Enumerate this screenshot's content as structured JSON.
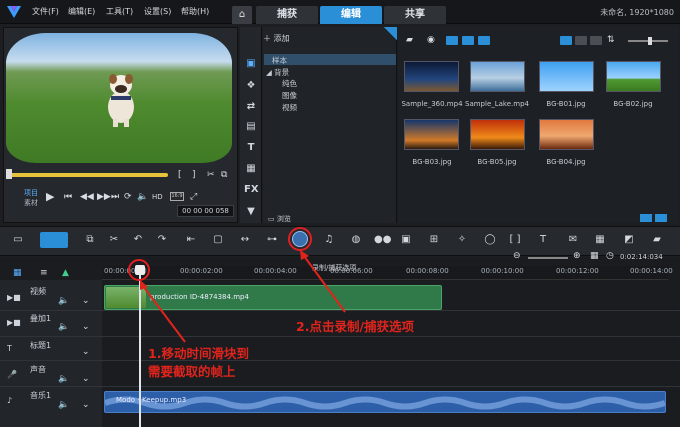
{
  "menu": [
    "文件(F)",
    "编辑(E)",
    "工具(T)",
    "设置(S)",
    "帮助(H)"
  ],
  "tabs": [
    "捕获",
    "编辑",
    "共享"
  ],
  "active_tab": "编辑",
  "project_name": "未命名, 1920*1080",
  "preview": {
    "mode_project": "项目",
    "mode_clip": "素材",
    "quality": "HD",
    "timecode": "00 00 00 058"
  },
  "library": {
    "add_label": "添加",
    "tree": [
      "样本",
      "背景",
      "纯色",
      "图像",
      "视频"
    ],
    "browse_label": "浏览",
    "items": [
      {
        "name": "Sample_360.mp4"
      },
      {
        "name": "Sample_Lake.mp4"
      },
      {
        "name": "BG-B01.jpg"
      },
      {
        "name": "BG-B02.jpg"
      },
      {
        "name": "BG-B03.jpg"
      },
      {
        "name": "BG-B05.jpg"
      },
      {
        "name": "BG-B04.jpg"
      }
    ]
  },
  "toolbar": {
    "tooltip": "录制/捕获选项",
    "timecode_right": "0:02:14:034"
  },
  "ruler": [
    "00:00:00:00",
    "00:00:02:00",
    "00:00:04:00",
    "00:00:06:00",
    "00:00:08:00",
    "00:00:10:00",
    "00:00:12:00",
    "00:00:14:00"
  ],
  "tracks": [
    "视频",
    "叠加1",
    "标题1",
    "声音",
    "音乐1"
  ],
  "clips": {
    "video": "production ID-4874384.mp4",
    "audio": "Modo - Keepup.mp3"
  },
  "annotations": {
    "step1_line1": "1.移动时间滑块到",
    "step1_line2": "需要截取的帧上",
    "step2": "2.点击录制/捕获选项"
  },
  "colors": {
    "accent": "#2b8fd8",
    "annotation": "#e0241c",
    "video_clip": "#2f7a48",
    "audio_clip": "#2d5fa8"
  }
}
